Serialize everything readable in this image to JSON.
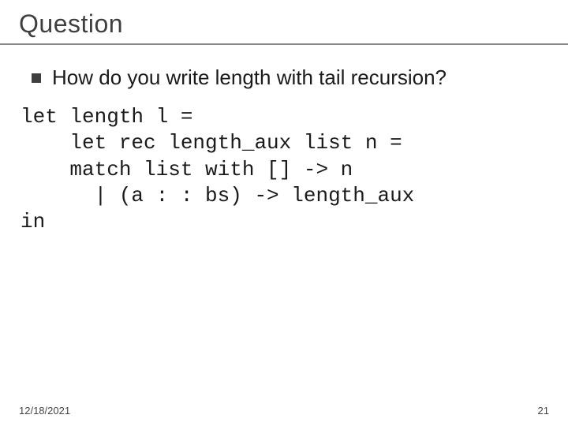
{
  "slide": {
    "title": "Question",
    "bullet_text": "How do you write length with tail recursion?",
    "code": {
      "l1": "let length l =",
      "l2": "    let rec length_aux list n =",
      "l3": "    match list with [] -> n",
      "l4": "      | (a : : bs) -> length_aux",
      "l5": "in"
    },
    "footer": {
      "date": "12/18/2021",
      "page": "21"
    }
  }
}
